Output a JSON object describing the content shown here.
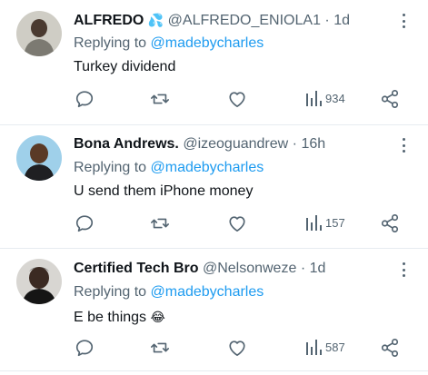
{
  "replies": [
    {
      "name": "ALFREDO",
      "verified_emoji": "💦",
      "handle": "@ALFREDO_ENIOLA1",
      "separator": "·",
      "time": "1d",
      "replying_prefix": "Replying to",
      "replying_to": "@madebycharles",
      "text": "Turkey dividend",
      "emoji": "",
      "views": "934"
    },
    {
      "name": "Bona Andrews.",
      "handle": "@izeoguandrew",
      "separator": "·",
      "time": "16h",
      "replying_prefix": "Replying to",
      "replying_to": "@madebycharles",
      "text": "U send them iPhone money",
      "emoji": "",
      "views": "157"
    },
    {
      "name": "Certified Tech Bro",
      "handle": "@Nelsonweze",
      "separator": "·",
      "time": "1d",
      "replying_prefix": "Replying to",
      "replying_to": "@madebycharles",
      "text": "E be things",
      "emoji": "😂",
      "views": "587"
    }
  ],
  "icons": {
    "reply": "reply-icon",
    "retweet": "retweet-icon",
    "like": "heart-icon",
    "views": "views-icon",
    "share": "share-icon",
    "more": "more-icon"
  },
  "colors": {
    "text": "#0f1419",
    "secondary": "#536471",
    "link": "#1d9bf0",
    "divider": "#e6ecf0"
  }
}
